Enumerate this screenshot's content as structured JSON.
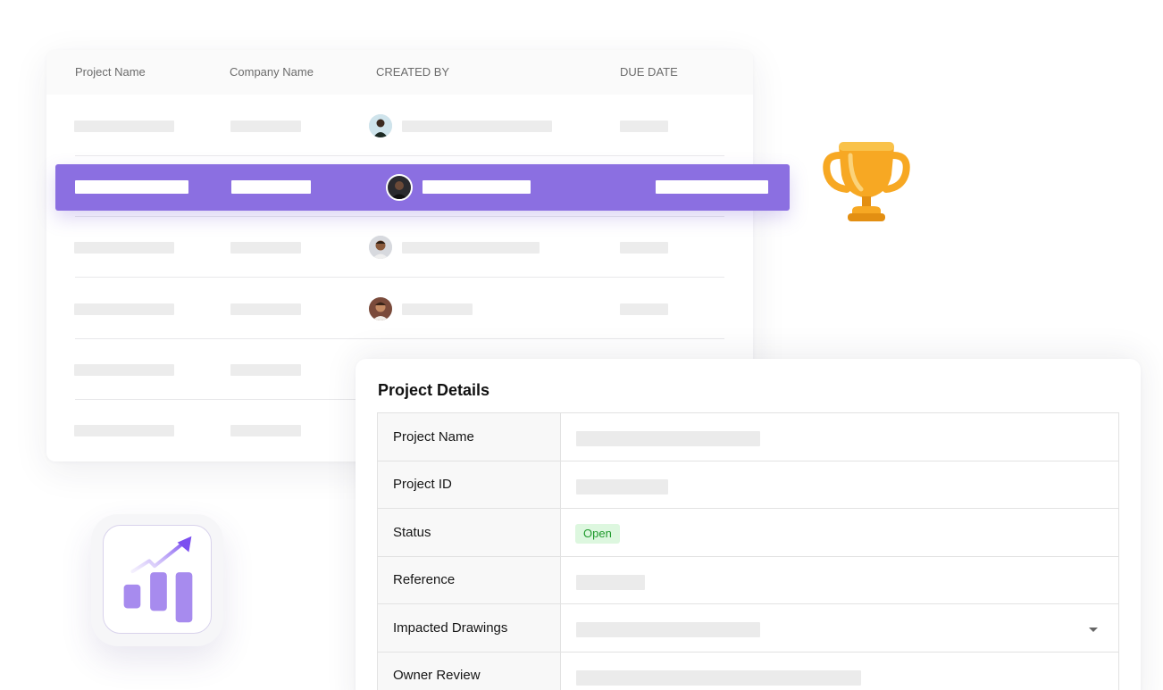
{
  "project_table": {
    "columns": [
      "Project Name",
      "Company Name",
      "CREATED BY",
      "DUE DATE"
    ]
  },
  "project_details": {
    "title": "Project Details",
    "fields": [
      {
        "label": "Project Name"
      },
      {
        "label": "Project ID"
      },
      {
        "label": "Status",
        "value": "Open"
      },
      {
        "label": "Reference"
      },
      {
        "label": "Impacted Drawings",
        "icon": "chevron-down-icon"
      },
      {
        "label": "Owner Review"
      }
    ]
  },
  "colors": {
    "selected_row": "#8b6fe1",
    "status_open_bg": "#ddf7df",
    "status_open_text": "#1f9a2c",
    "trophy": "#f7a823",
    "growth_bars": "#a78bee"
  },
  "icons": [
    "trophy-icon",
    "growth-chart-icon",
    "chevron-down-icon",
    "avatar"
  ]
}
